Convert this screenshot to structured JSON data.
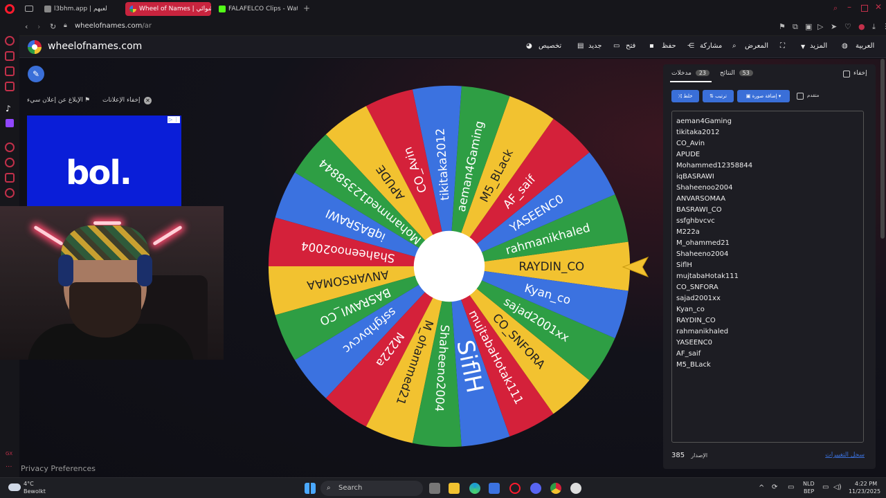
{
  "browser": {
    "tabs": [
      {
        "label": "l3bhm.app | لعبهم",
        "active": false
      },
      {
        "label": "Wheel of Names | عشوائي",
        "active": true
      },
      {
        "label": "FALAFELCO Clips - Watch",
        "active": false
      }
    ],
    "url_host": "wheelofnames.com",
    "url_path": "/ar"
  },
  "site": {
    "name": "wheelofnames.com",
    "menu": {
      "language": "العربية",
      "more": "المزيد",
      "gallery": "المعرض",
      "share": "مشاركة",
      "save": "حفظ",
      "open": "فتح",
      "new": "جديد",
      "customize": "تخصيص"
    }
  },
  "left": {
    "report_ad": "الإبلاغ عن إعلان سيء",
    "hide_ads": "إخفاء الإعلانات",
    "ad_text": "bol.",
    "privacy": "Privacy Preferences"
  },
  "wheel": {
    "colors": [
      "#3b72e0",
      "#2e9e44",
      "#f2c230",
      "#d4213a"
    ],
    "selected": "RAYDIN_CO",
    "segments": [
      "RAYDIN_CO",
      "rahmanikhaled",
      "YASEENC0",
      "AF_saif",
      "M5_BLack",
      "aeman4Gaming",
      "tikitaka2012",
      "CO_Avin",
      "APUDE",
      "Mohammed12358844",
      "iqBASRAWI",
      "Shaheenoo2004",
      "ANVARSOMAA",
      "BASRAWI_CO",
      "ssfghbvcvc",
      "M222a",
      "M_ohammed21",
      "Shaheeno2004",
      "SiflH",
      "mujtabaHotak111",
      "CO_SNFORA",
      "sajad2001xx",
      "Kyan_co"
    ]
  },
  "panel": {
    "hide_label": "إخفاء",
    "results_tab": "النتائج",
    "results_count": "53",
    "entries_tab": "مدخلات",
    "entries_count": "23",
    "shuffle": "خلط",
    "sort": "ترتيب",
    "add_image": "إضافة صورة",
    "advanced": "متقدم",
    "entries": [
      "aeman4Gaming",
      "tikitaka2012",
      "CO_Avin",
      "APUDE",
      "Mohammed12358844",
      "iqBASRAWI",
      "Shaheenoo2004",
      "ANVARSOMAA",
      "BASRAWI_CO",
      "ssfghbvcvc",
      "M222a",
      "M_ohammed21",
      "Shaheeno2004",
      "SiflH",
      "mujtabaHotak111",
      "CO_SNFORA",
      "sajad2001xx",
      "Kyan_co",
      "RAYDIN_CO",
      "rahmanikhaled",
      "YASEENC0",
      "AF_saif",
      "M5_BLack"
    ],
    "version_number": "385",
    "version_label": "الإصدار",
    "changelog": "سجل التغييرات"
  },
  "taskbar": {
    "weather_temp": "4°C",
    "weather_desc": "Bewolkt",
    "search": "Search",
    "lang": "NLD",
    "lang2": "BEP",
    "time": "4:22 PM",
    "date": "11/23/2025"
  }
}
